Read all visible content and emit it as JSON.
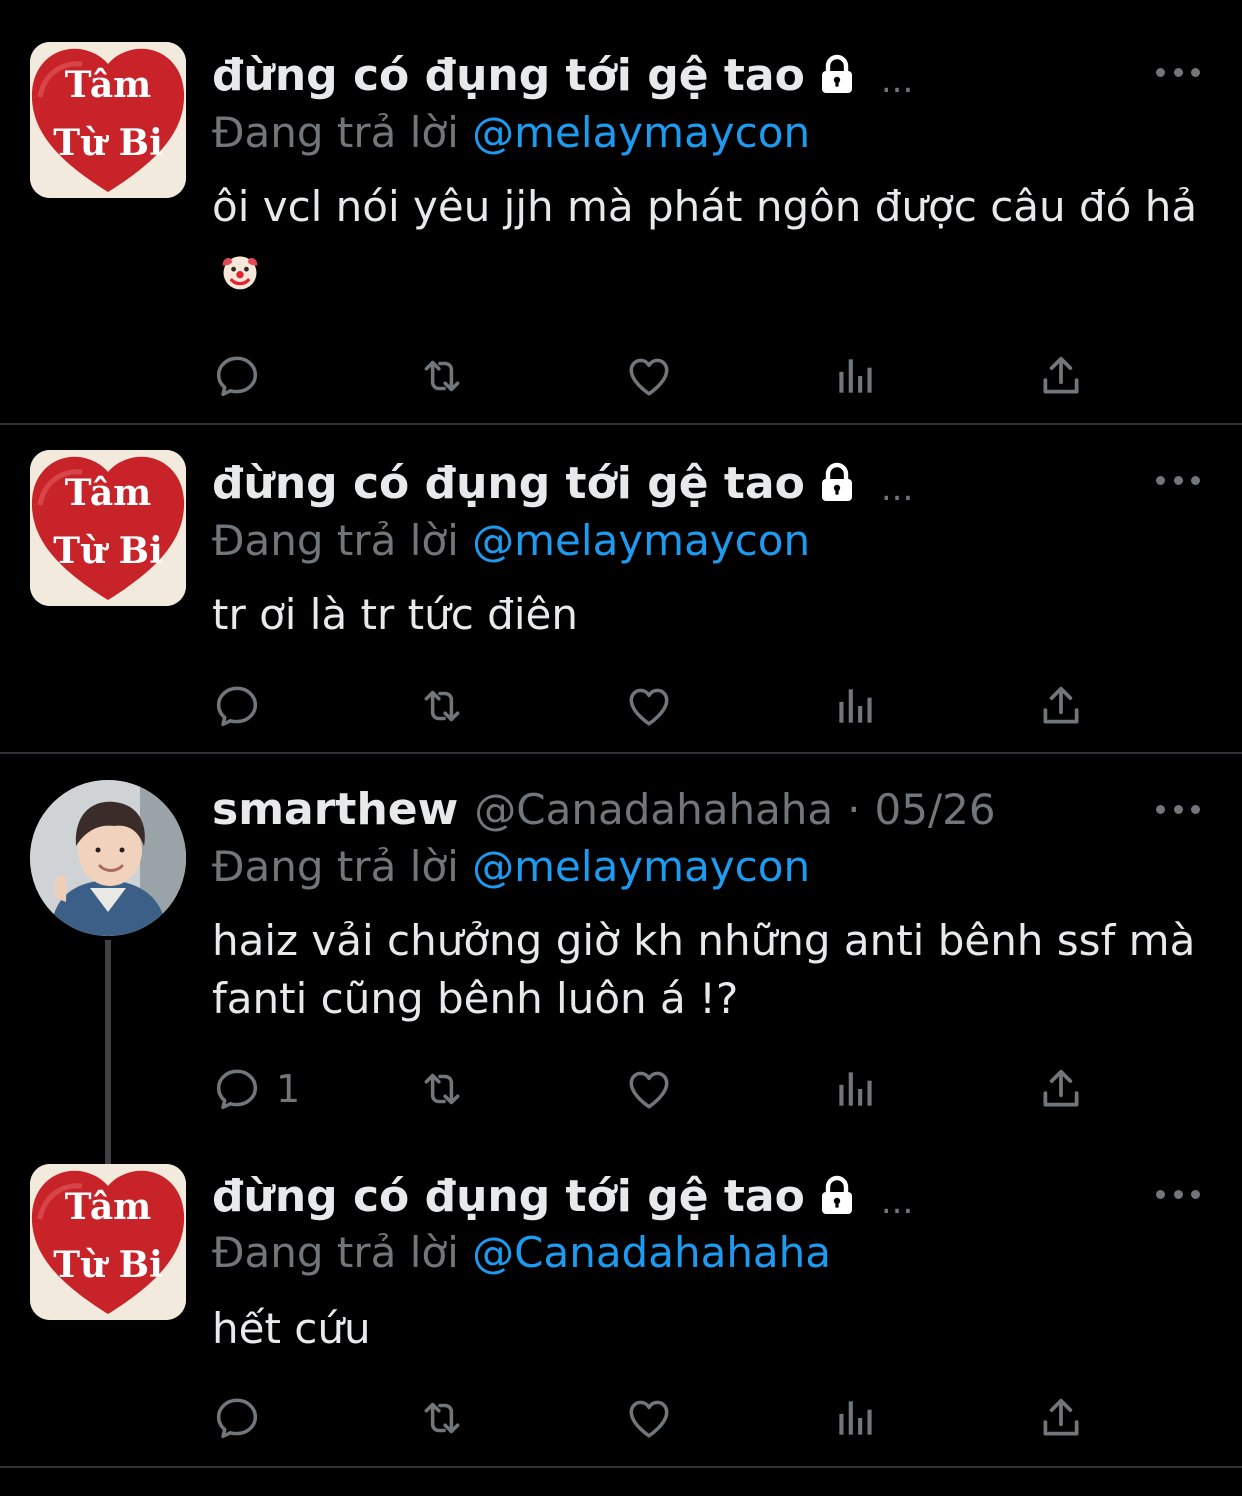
{
  "colors": {
    "background": "#000000",
    "text": "#e7e9ea",
    "secondary": "#71767b",
    "link": "#1d9bf0",
    "divider": "#2f3336"
  },
  "tweets": [
    {
      "author": {
        "name": "đừng có đụng tới gệ tao",
        "protected_icon": "lock-icon",
        "truncation": "...",
        "avatar_text": [
          "Tâm",
          "Từ Bi"
        ]
      },
      "reply_label": "Đang trả lời",
      "reply_to": "@melaymaycon",
      "text": "ôi vcl nói yêu jjh mà phát ngôn được câu đó hả",
      "emoji_icon": "clown-face-icon",
      "reply_count": ""
    },
    {
      "author": {
        "name": "đừng có đụng tới gệ tao",
        "protected_icon": "lock-icon",
        "truncation": "...",
        "avatar_text": [
          "Tâm",
          "Từ Bi"
        ]
      },
      "reply_label": "Đang trả lời",
      "reply_to": "@melaymaycon",
      "text": "tr ơi là tr tức điên",
      "reply_count": ""
    },
    {
      "author": {
        "name": "smarthew",
        "handle": "@Canadahahaha",
        "separator": "·",
        "date": "05/26"
      },
      "reply_label": "Đang trả lời",
      "reply_to": "@melaymaycon",
      "text": "haiz vải chưởng giờ kh những anti bênh ssf mà fanti cũng bênh luôn á !?",
      "reply_count": "1"
    },
    {
      "author": {
        "name": "đừng có đụng tới gệ tao",
        "protected_icon": "lock-icon",
        "truncation": "...",
        "avatar_text": [
          "Tâm",
          "Từ Bi"
        ]
      },
      "reply_label": "Đang trả lời",
      "reply_to": "@Canadahahaha",
      "text": "hết cứu",
      "reply_count": ""
    }
  ],
  "action_icons": [
    "reply-icon",
    "retweet-icon",
    "like-icon",
    "analytics-icon",
    "share-icon"
  ]
}
